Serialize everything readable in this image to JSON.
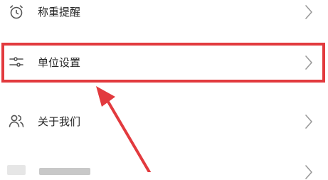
{
  "settings": {
    "items": [
      {
        "label": "称重提醒",
        "icon": "alarm-clock-icon"
      },
      {
        "label": "单位设置",
        "icon": "sliders-icon",
        "highlighted": true
      },
      {
        "label": "关于我们",
        "icon": "users-icon"
      },
      {
        "label": "",
        "icon": "obscured-icon"
      }
    ],
    "chevron_icon": "chevron-right-icon"
  },
  "annotation": {
    "highlight_color": "#e23a3e",
    "arrow_color": "#e23a3e"
  },
  "colors": {
    "text": "#262626",
    "icon": "#555555",
    "chevron": "#9a9a9a",
    "background": "#ffffff"
  }
}
